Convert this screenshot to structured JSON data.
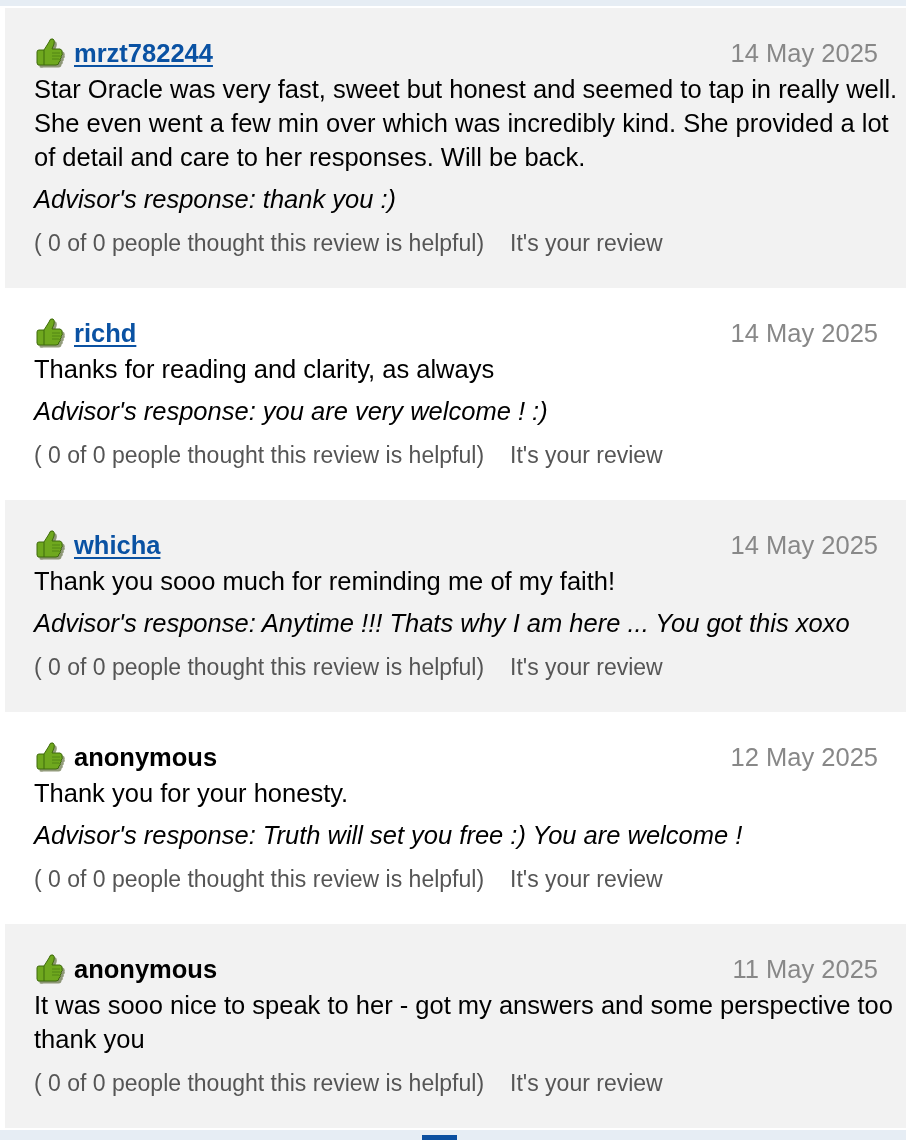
{
  "reviews": [
    {
      "author": {
        "name": "mrzt782244",
        "kind": "link"
      },
      "date": "14 May 2025",
      "text": "Star Oracle was very fast, sweet but honest and seemed to tap in really well. She even went a few min over which was incredibly kind. She provided a lot of detail and care to her responses. Will be back.",
      "response": "Advisor's response: thank you :)",
      "helpful": "( 0 of 0 people thought this review is helpful)",
      "note": "It's your review"
    },
    {
      "author": {
        "name": "richd",
        "kind": "link"
      },
      "date": "14 May 2025",
      "text": "Thanks for reading and clarity, as always",
      "response": "Advisor's response: you are very welcome ! :)",
      "helpful": "( 0 of 0 people thought this review is helpful)",
      "note": "It's your review"
    },
    {
      "author": {
        "name": "whicha",
        "kind": "link"
      },
      "date": "14 May 2025",
      "text": "Thank you sooo much for reminding me of my faith!",
      "response": "Advisor's response: Anytime !!! Thats why I am here ... You got this xoxo",
      "helpful": "( 0 of 0 people thought this review is helpful)",
      "note": "It's your review"
    },
    {
      "author": {
        "name": "anonymous",
        "kind": "plain"
      },
      "date": "12 May 2025",
      "text": "Thank you for your honesty.",
      "response": "Advisor's response: Truth will set you free :) You are welcome !",
      "helpful": "( 0 of 0 people thought this review is helpful)",
      "note": "It's your review"
    },
    {
      "author": {
        "name": "anonymous",
        "kind": "plain"
      },
      "date": "11 May 2025",
      "text": "It was sooo nice to speak to her - got my answers and some perspective too thank you",
      "helpful": "( 0 of 0 people thought this review is helpful)",
      "note": "It's your review"
    }
  ]
}
